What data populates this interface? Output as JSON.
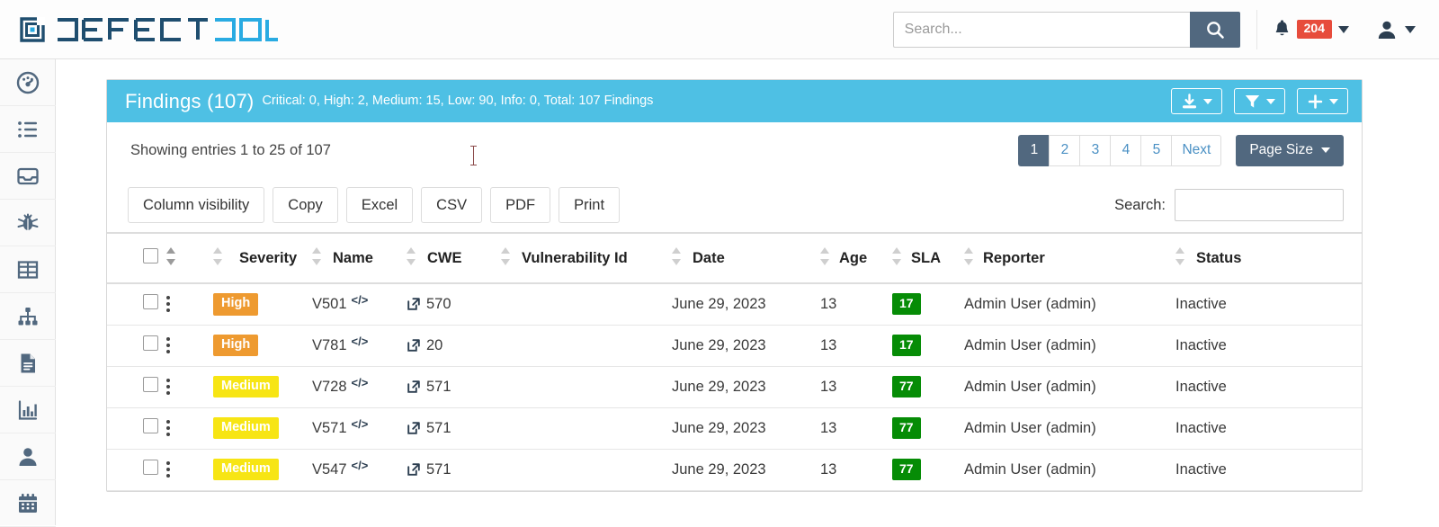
{
  "navbar": {
    "brand": "DEFECTDOJO",
    "brand_primary": "DEFECT",
    "brand_accent": "DOJO",
    "search_placeholder": "Search...",
    "search_value": "",
    "search_icon": "search-icon",
    "bell_icon": "bell-icon",
    "notification_count": "204",
    "user_icon": "user-icon"
  },
  "sidebar": {
    "items": [
      {
        "icon": "dashboard-icon"
      },
      {
        "icon": "list-icon"
      },
      {
        "icon": "inbox-icon"
      },
      {
        "icon": "bug-icon"
      },
      {
        "icon": "grid-icon"
      },
      {
        "icon": "sitemap-icon"
      },
      {
        "icon": "document-icon"
      },
      {
        "icon": "bar-chart-icon"
      },
      {
        "icon": "person-icon"
      },
      {
        "icon": "calendar-icon"
      }
    ]
  },
  "panel": {
    "title": "Findings (107)",
    "subtitle": "Critical: 0, High: 2, Medium: 15, Low: 90, Info: 0, Total: 107 Findings",
    "header_color": "#4ec0e4",
    "buttons": [
      {
        "name": "download-button",
        "icon": "download-icon"
      },
      {
        "name": "filter-button",
        "icon": "funnel-icon"
      },
      {
        "name": "add-button",
        "icon": "plus-icon"
      }
    ]
  },
  "toolbar": {
    "showing": "Showing entries 1 to 25 of 107",
    "pages": [
      "1",
      "2",
      "3",
      "4",
      "5"
    ],
    "active_page": "1",
    "next_label": "Next",
    "page_size_label": "Page Size"
  },
  "export": {
    "buttons": [
      "Column visibility",
      "Copy",
      "Excel",
      "CSV",
      "PDF",
      "Print"
    ],
    "search_label": "Search:",
    "search_value": "",
    "search_placeholder": ""
  },
  "table": {
    "columns": [
      "Severity",
      "Name",
      "CWE",
      "Vulnerability Id",
      "Date",
      "Age",
      "SLA",
      "Reporter",
      "Status"
    ],
    "rows": [
      {
        "severity": "High",
        "severity_class": "high",
        "name": "V501",
        "cwe": "570",
        "vulnerability_id": "",
        "date": "June 29, 2023",
        "age": "13",
        "sla": "17",
        "reporter": "Admin User (admin)",
        "status": "Inactive"
      },
      {
        "severity": "High",
        "severity_class": "high",
        "name": "V781",
        "cwe": "20",
        "vulnerability_id": "",
        "date": "June 29, 2023",
        "age": "13",
        "sla": "17",
        "reporter": "Admin User (admin)",
        "status": "Inactive"
      },
      {
        "severity": "Medium",
        "severity_class": "medium",
        "name": "V728",
        "cwe": "571",
        "vulnerability_id": "",
        "date": "June 29, 2023",
        "age": "13",
        "sla": "77",
        "reporter": "Admin User (admin)",
        "status": "Inactive"
      },
      {
        "severity": "Medium",
        "severity_class": "medium",
        "name": "V571",
        "cwe": "571",
        "vulnerability_id": "",
        "date": "June 29, 2023",
        "age": "13",
        "sla": "77",
        "reporter": "Admin User (admin)",
        "status": "Inactive"
      },
      {
        "severity": "Medium",
        "severity_class": "medium",
        "name": "V547",
        "cwe": "571",
        "vulnerability_id": "",
        "date": "June 29, 2023",
        "age": "13",
        "sla": "77",
        "reporter": "Admin User (admin)",
        "status": "Inactive"
      }
    ]
  },
  "colors": {
    "brand_dark": "#1f4e6f",
    "brand_light": "#29abe2",
    "panel_header": "#4ec0e4",
    "accent_dark": "#51687f",
    "high": "#ee9a30",
    "medium": "#f7e514",
    "sla_green": "#068c06",
    "notif_red": "#e74c3c"
  }
}
